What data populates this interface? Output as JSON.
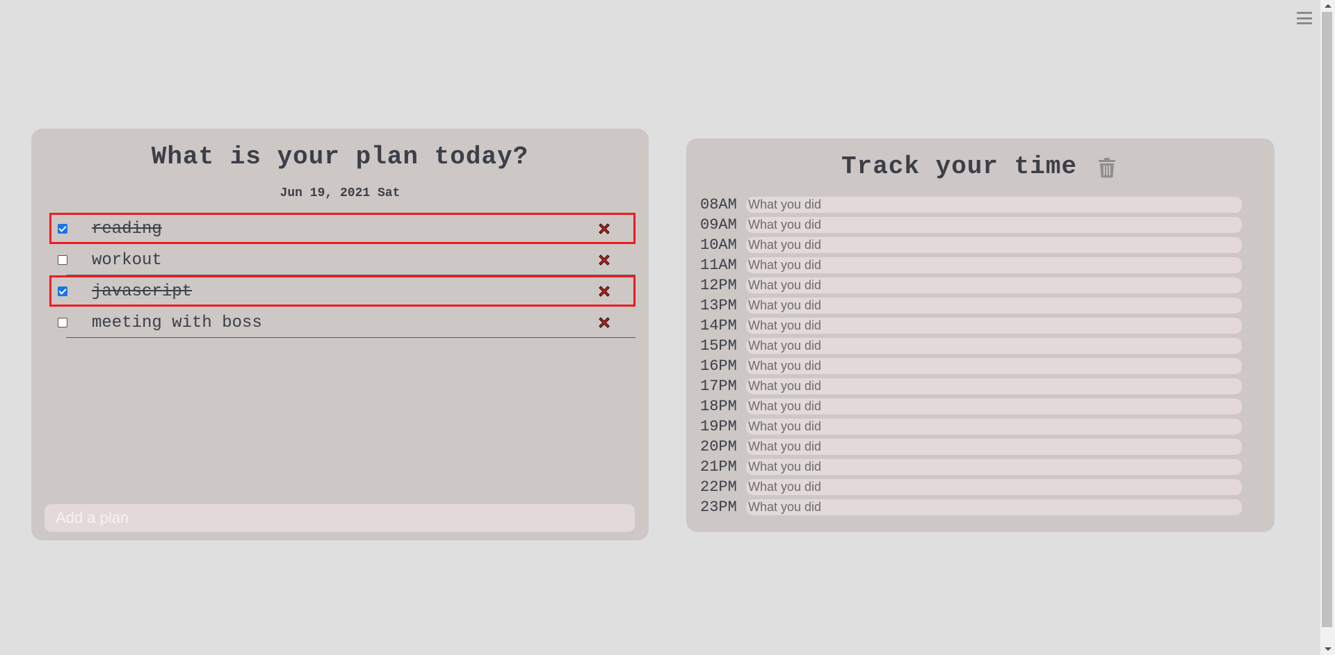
{
  "menu": {
    "icon": "hamburger-menu-icon"
  },
  "plan": {
    "title": "What is your plan today?",
    "date": "Jun 19, 2021 Sat",
    "items": [
      {
        "label": "reading",
        "checked": true,
        "highlighted": true
      },
      {
        "label": "workout",
        "checked": false,
        "highlighted": false
      },
      {
        "label": "javascript",
        "checked": true,
        "highlighted": true
      },
      {
        "label": "meeting with boss",
        "checked": false,
        "highlighted": false
      }
    ],
    "input_placeholder": "Add a plan",
    "delete_icon": "red-x-icon",
    "highlight_color": "#ec1c24"
  },
  "track": {
    "title": "Track your time",
    "trash_icon": "trash-icon",
    "input_placeholder": "What you did",
    "hours": [
      "08AM",
      "09AM",
      "10AM",
      "11AM",
      "12PM",
      "13PM",
      "14PM",
      "15PM",
      "16PM",
      "17PM",
      "18PM",
      "19PM",
      "20PM",
      "21PM",
      "22PM",
      "23PM"
    ]
  },
  "colors": {
    "background": "#e0dfdf",
    "panel": "#cdc7c5",
    "input": "#e3d9d9",
    "text": "#3c3f48",
    "delete": "#d0281e"
  }
}
